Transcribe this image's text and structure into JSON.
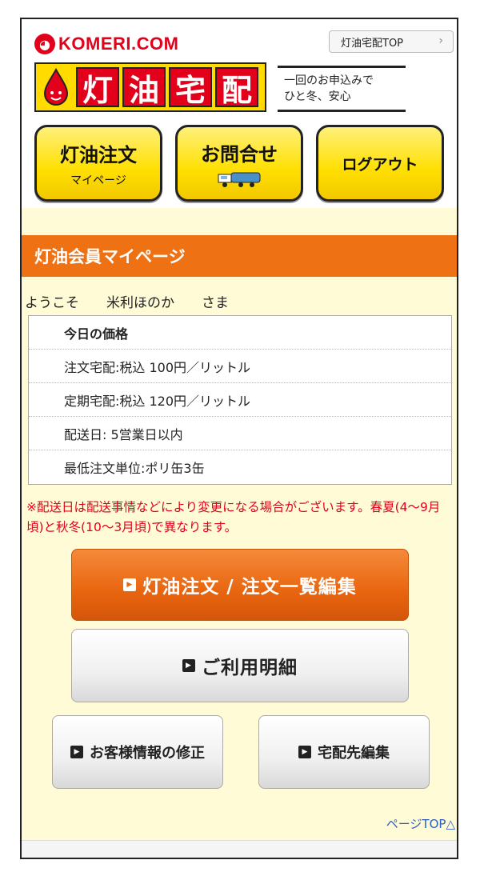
{
  "header": {
    "logo_text": "KOMERI.COM",
    "top_link": "灯油宅配TOP",
    "top_link_chevron": "›",
    "service_chars": [
      "灯",
      "油",
      "宅",
      "配"
    ],
    "tagline_line1": "一回のお申込みで",
    "tagline_line2": "ひと冬、安心"
  },
  "nav": {
    "order_main": "灯油注文",
    "order_sub": "マイページ",
    "contact_main": "お問合せ",
    "logout": "ログアウト"
  },
  "section_title": "灯油会員マイページ",
  "welcome": "ようこそ　　米利ほのか　　さま",
  "prices": {
    "heading": "今日の価格",
    "rows": [
      "注文宅配:税込 100円／リットル",
      "定期宅配:税込 120円／リットル",
      "配送日: 5営業日以内",
      "最低注文単位:ポリ缶3缶"
    ]
  },
  "notice": "※配送日は配送事情などにより変更になる場合がございます。春夏(4〜9月頃)と秋冬(10〜3月頃)で異なります。",
  "buttons": {
    "order_list": "灯油注文 / 注文一覧編集",
    "usage": "ご利用明細",
    "customer_info": "お客様情報の修正",
    "delivery_edit": "宅配先編集",
    "arrow_glyph": "▶"
  },
  "page_top": "ページTOP△",
  "colors": {
    "brand_red": "#e3001b",
    "accent_orange": "#ee7113",
    "nav_yellow": "#ffdf00",
    "background_cream": "#fffbd6",
    "link_blue": "#2a5fc4"
  }
}
